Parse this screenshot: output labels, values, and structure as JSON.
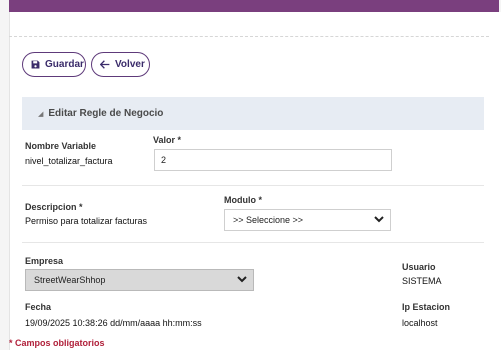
{
  "toolbar": {
    "save_label": "Guardar",
    "back_label": "Volver",
    "save_icon": "save-icon",
    "back_icon": "arrow-left-icon"
  },
  "section": {
    "title": "Editar Regle de Negocio"
  },
  "form": {
    "nombre_variable_label": "Nombre Variable",
    "nombre_variable_value": "nivel_totalizar_factura",
    "valor_label": "Valor *",
    "valor_value": "2",
    "descripcion_label": "Descripcion *",
    "descripcion_value": "Permiso para totalizar facturas",
    "modulo_label": "Modulo *",
    "modulo_value": ">> Seleccione >>",
    "empresa_label": "Empresa",
    "empresa_value": "StreetWearShhop",
    "usuario_label": "Usuario",
    "usuario_value": "SISTEMA",
    "fecha_label": "Fecha",
    "fecha_value": "19/09/2025 10:38:26  dd/mm/aaaa hh:mm:ss",
    "ip_label": "Ip Estacion",
    "ip_value": "localhost"
  },
  "footer": {
    "required_note": "* Campos obligatorios"
  },
  "colors": {
    "accent": "#7a3f7e",
    "button_text": "#3a2b6a",
    "header_bg": "#e7ecf3",
    "required": "#b0203a"
  }
}
